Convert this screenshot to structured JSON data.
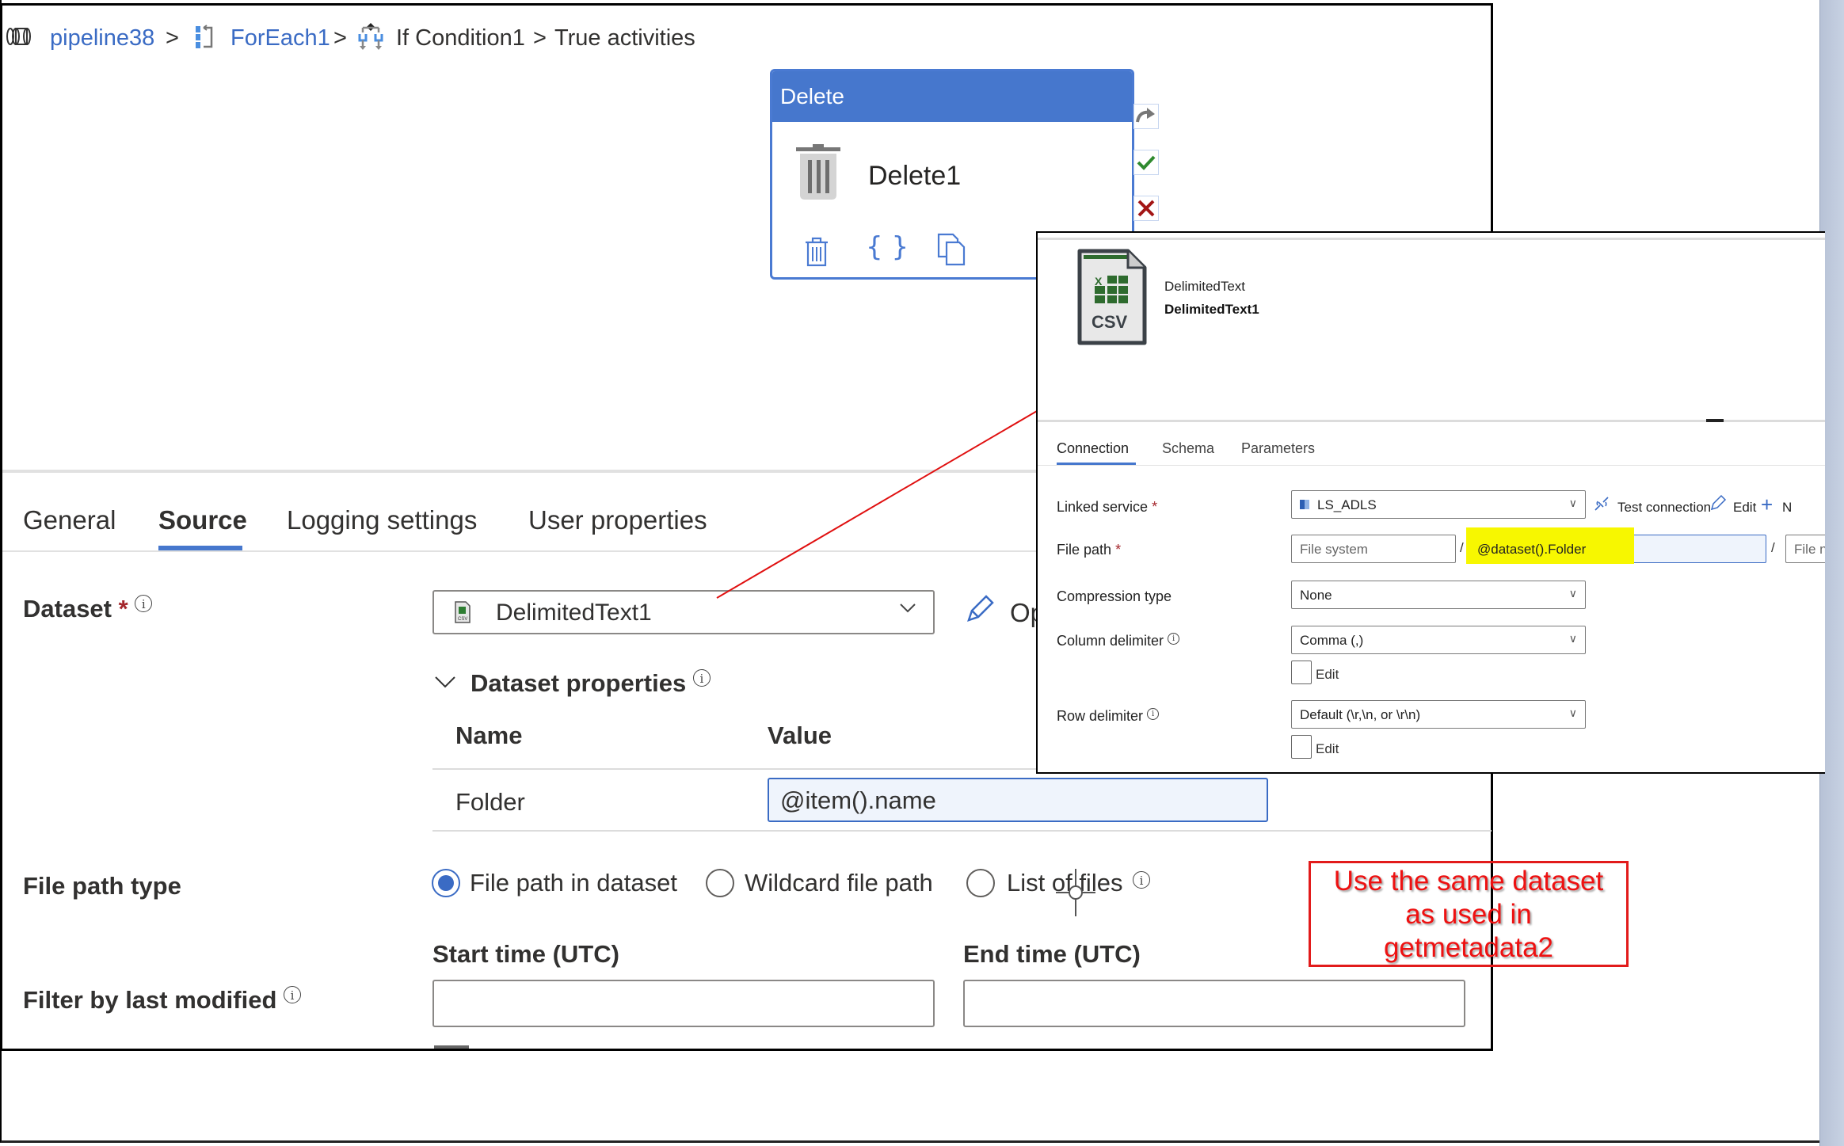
{
  "breadcrumb": {
    "pipeline": "pipeline38",
    "foreach": "ForEach1",
    "ifcondition": "If Condition1",
    "current": "True activities",
    "separator": ">"
  },
  "activity": {
    "type": "Delete",
    "name": "Delete1",
    "side_actions": [
      "redo-arrow",
      "success-check",
      "failure-x"
    ],
    "footer_actions": [
      "delete-icon",
      "code-icon",
      "copy-icon"
    ]
  },
  "tabs": {
    "items": [
      "General",
      "Source",
      "Logging settings",
      "User properties"
    ],
    "active": "Source"
  },
  "source": {
    "dataset_label": "Dataset",
    "dataset_value": "DelimitedText1",
    "open_label": "Op",
    "dataset_properties_label": "Dataset properties",
    "props_table": {
      "headers": [
        "Name",
        "Value"
      ],
      "rows": [
        {
          "name": "Folder",
          "value": "@item().name"
        }
      ]
    },
    "file_path_type_label": "File path type",
    "file_path_options": [
      "File path in dataset",
      "Wildcard file path",
      "List of files"
    ],
    "file_path_selected": "File path in dataset",
    "filter_label": "Filter by last modified",
    "start_time_label": "Start time (UTC)",
    "end_time_label": "End time (UTC)",
    "start_time_value": "",
    "end_time_value": ""
  },
  "dataset_panel": {
    "type_label": "DelimitedText",
    "name": "DelimitedText1",
    "icon_text": "CSV",
    "tabs": [
      "Connection",
      "Schema",
      "Parameters"
    ],
    "active_tab": "Connection",
    "linked_service_label": "Linked service",
    "linked_service_value": "LS_ADLS",
    "test_connection": "Test connection",
    "edit": "Edit",
    "new_partial": "N",
    "file_path_label": "File path",
    "file_system_placeholder": "File system",
    "directory_value": "@dataset().Folder",
    "file_name_placeholder": "File na",
    "path_separator": "/",
    "compression_label": "Compression type",
    "compression_value": "None",
    "column_delim_label": "Column delimiter",
    "column_delim_value": "Comma (,)",
    "row_delim_label": "Row delimiter",
    "row_delim_value": "Default (\\r,\\n, or \\r\\n)",
    "edit_checkbox_label": "Edit"
  },
  "annotation": {
    "lines": [
      "Use the same dataset",
      "as used in",
      "getmetadata2"
    ],
    "color": "#ee1111"
  },
  "colors": {
    "accent": "#4677cd",
    "link": "#3a6bc4",
    "highlight": "#f7f700",
    "required": "#a4262c"
  }
}
